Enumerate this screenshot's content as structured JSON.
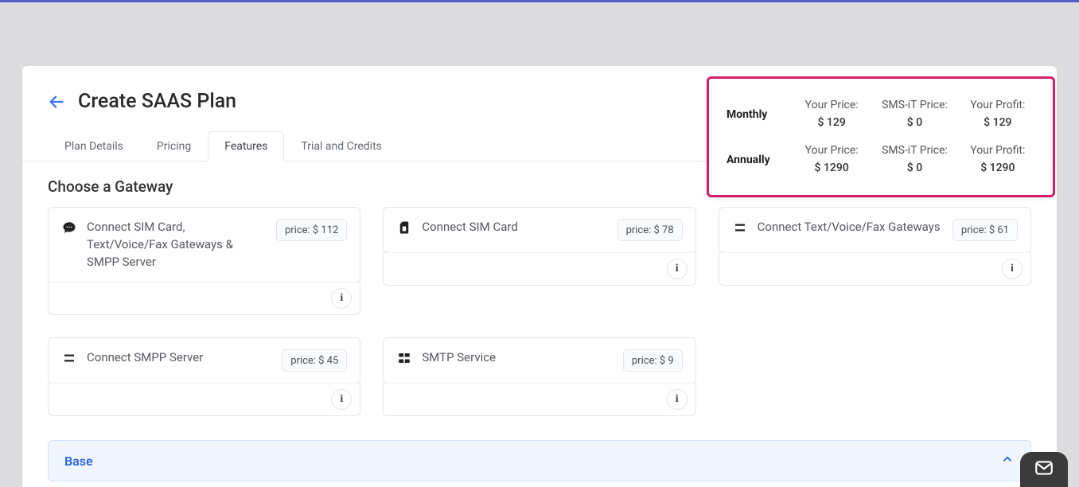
{
  "page_title": "Create SAAS Plan",
  "tabs": {
    "plan_details": "Plan Details",
    "pricing": "Pricing",
    "features": "Features",
    "trial_credits": "Trial and Credits"
  },
  "active_tab": "features",
  "section_choose_gateway": "Choose a Gateway",
  "gateways": [
    {
      "label": "Connect SIM Card, Text/Voice/Fax Gateways & SMPP Server",
      "price": "price: $ 112"
    },
    {
      "label": "Connect SIM Card",
      "price": "price: $ 78"
    },
    {
      "label": "Connect Text/Voice/Fax Gateways",
      "price": "price: $ 61"
    },
    {
      "label": "Connect SMPP Server",
      "price": "price: $ 45"
    },
    {
      "label": "SMTP Service",
      "price": "price: $ 9"
    }
  ],
  "info_glyph": "i",
  "accordion": {
    "base": "Base"
  },
  "summary": {
    "periods": {
      "monthly": "Monthly",
      "annually": "Annually"
    },
    "labels": {
      "your_price": "Your Price:",
      "smsit_price": "SMS-iT Price:",
      "your_profit": "Your Profit:"
    },
    "monthly": {
      "your_price": "$ 129",
      "smsit_price": "$ 0",
      "your_profit": "$ 129"
    },
    "annually": {
      "your_price": "$ 1290",
      "smsit_price": "$ 0",
      "your_profit": "$ 1290"
    }
  }
}
